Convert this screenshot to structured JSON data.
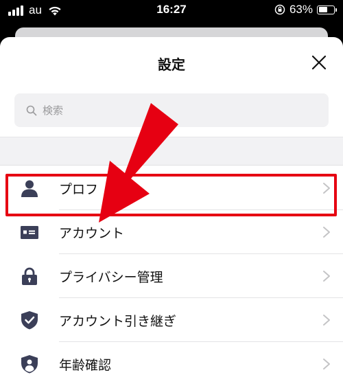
{
  "status_bar": {
    "carrier": "au",
    "time": "16:27",
    "battery_percent": "63%",
    "battery_level": 0.63,
    "icons": [
      "signal-icon",
      "wifi-icon",
      "rotation-lock-icon",
      "battery-icon"
    ]
  },
  "sheet": {
    "title": "設定",
    "close_icon": "close-icon"
  },
  "search": {
    "placeholder": "検索",
    "value": "",
    "icon": "search-icon"
  },
  "menu": {
    "items": [
      {
        "label": "プロフ",
        "icon": "person-icon"
      },
      {
        "label": "アカウント",
        "icon": "id-card-icon"
      },
      {
        "label": "プライバシー管理",
        "icon": "lock-icon"
      },
      {
        "label": "アカウント引き継ぎ",
        "icon": "shield-check-icon"
      },
      {
        "label": "年齢確認",
        "icon": "shield-person-icon"
      }
    ]
  },
  "colors": {
    "accent_red": "#e60012",
    "icon_navy": "#3b3f58",
    "chevron_gray": "#c4c4c6"
  }
}
